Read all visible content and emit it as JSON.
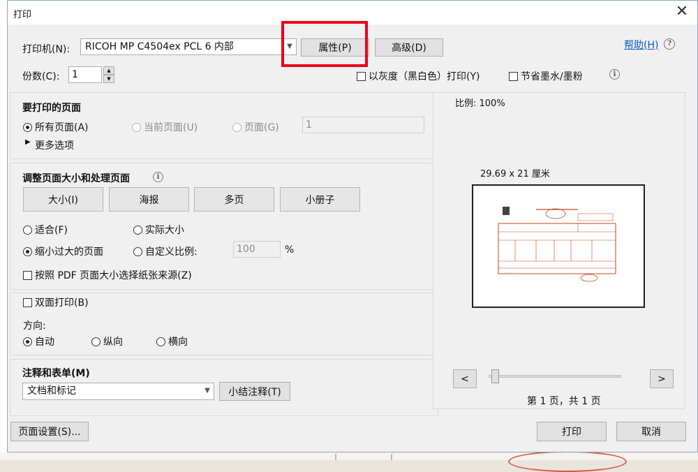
{
  "dialog": {
    "title": "打印",
    "close_glyph": "✕"
  },
  "printer": {
    "label": "打印机(N):",
    "selected": "RICOH MP C4504ex PCL 6 内部",
    "properties_button": "属性(P)",
    "advanced_button": "高级(D)",
    "help_link": "帮助(H)"
  },
  "copies": {
    "label": "份数(C):",
    "value": "1",
    "spin_up": "▲",
    "spin_down": "▼"
  },
  "options": {
    "grayscale": "以灰度（黑白色）打印(Y)",
    "save_ink": "节省墨水/墨粉"
  },
  "pages_to_print": {
    "title": "要打印的页面",
    "all_pages": "所有页面(A)",
    "current_page": "当前页面(U)",
    "pages": "页面(G)",
    "pages_value": "1",
    "more_options": "更多选项"
  },
  "page_sizing": {
    "title": "调整页面大小和处理页面",
    "tabs": [
      "大小(I)",
      "海报",
      "多页",
      "小册子"
    ],
    "fit": "适合(F)",
    "actual_size": "实际大小",
    "shrink_oversized": "缩小过大的页面",
    "custom_scale": "自定义比例:",
    "custom_scale_value": "100",
    "percent": "%",
    "pdf_paper_source": "按照 PDF 页面大小选择纸张来源(Z)"
  },
  "duplex": {
    "label": "双面打印(B)"
  },
  "orientation": {
    "label": "方向:",
    "auto": "自动",
    "portrait": "纵向",
    "landscape": "横向"
  },
  "comments_forms": {
    "title": "注释和表单(M)",
    "selected": "文档和标记",
    "summarize_button": "小结注释(T)"
  },
  "preview": {
    "scale": "比例: 100%",
    "paper_size": "29.69 x 21 厘米",
    "prev": "<",
    "next": ">",
    "page_info": "第 1 页，共 1 页",
    "slider_level": 0
  },
  "footer": {
    "page_setup": "页面设置(S)...",
    "print": "打印",
    "cancel": "取消"
  },
  "colors": {
    "highlight_box": "#e8001c",
    "link": "#0a5cc2",
    "invoice_ink": "#c2471f"
  },
  "icons": {
    "info": "info-circle-icon",
    "help": "question-circle-icon",
    "close": "close-icon"
  }
}
